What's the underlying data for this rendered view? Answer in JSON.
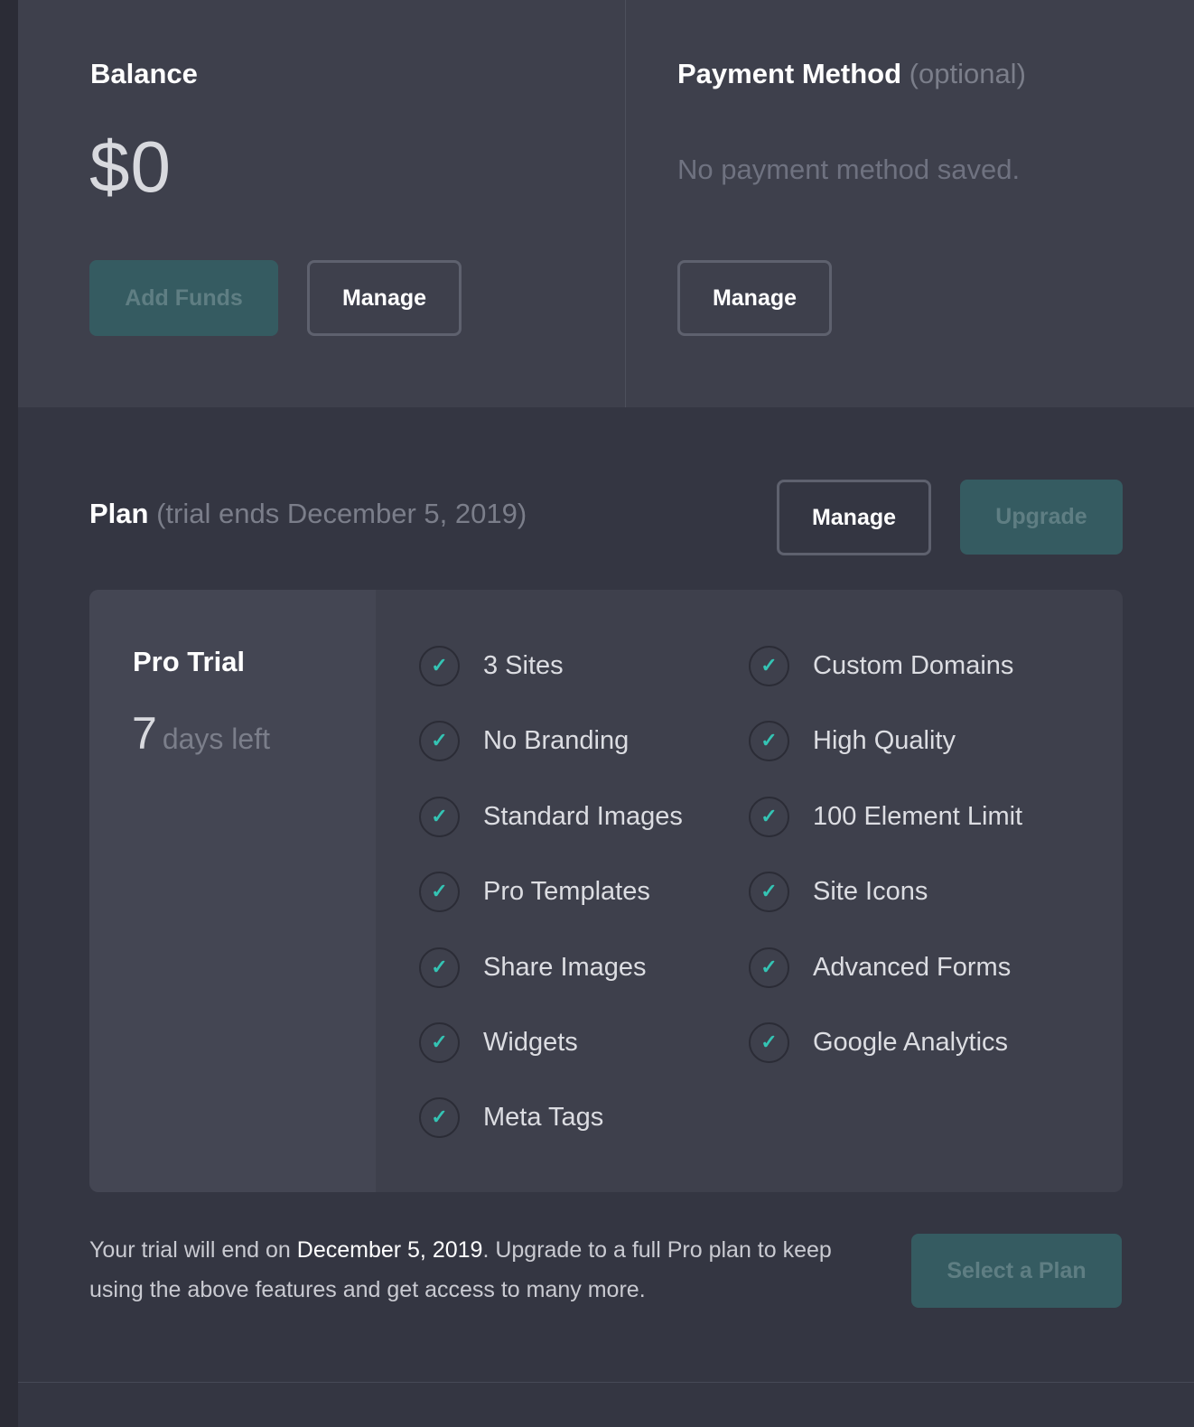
{
  "balance": {
    "title": "Balance",
    "amount": "$0",
    "add_funds_label": "Add Funds",
    "manage_label": "Manage"
  },
  "payment": {
    "title": "Payment Method",
    "optional_note": "(optional)",
    "empty_text": "No payment method saved.",
    "manage_label": "Manage"
  },
  "plan": {
    "title": "Plan",
    "trial_note": "(trial ends December 5, 2019)",
    "manage_label": "Manage",
    "upgrade_label": "Upgrade",
    "card": {
      "name": "Pro Trial",
      "days_left_number": "7",
      "days_left_label": "days left"
    },
    "features_left": [
      "3 Sites",
      "No Branding",
      "Standard Images",
      "Pro Templates",
      "Share Images",
      "Widgets",
      "Meta Tags"
    ],
    "features_right": [
      "Custom Domains",
      "High Quality",
      "100 Element Limit",
      "Site Icons",
      "Advanced Forms",
      "Google Analytics"
    ]
  },
  "footer": {
    "text_before": "Your trial will end on ",
    "date": "December 5, 2019",
    "text_after": ". Upgrade to a full Pro plan to keep using the above features and get access to many more.",
    "select_plan_label": "Select a Plan"
  },
  "colors": {
    "accent": "#34c4b4",
    "teal_button": "#355b61",
    "panel": "#3e404c",
    "background": "#343642"
  },
  "icons": {
    "feature_check": "check-icon"
  }
}
